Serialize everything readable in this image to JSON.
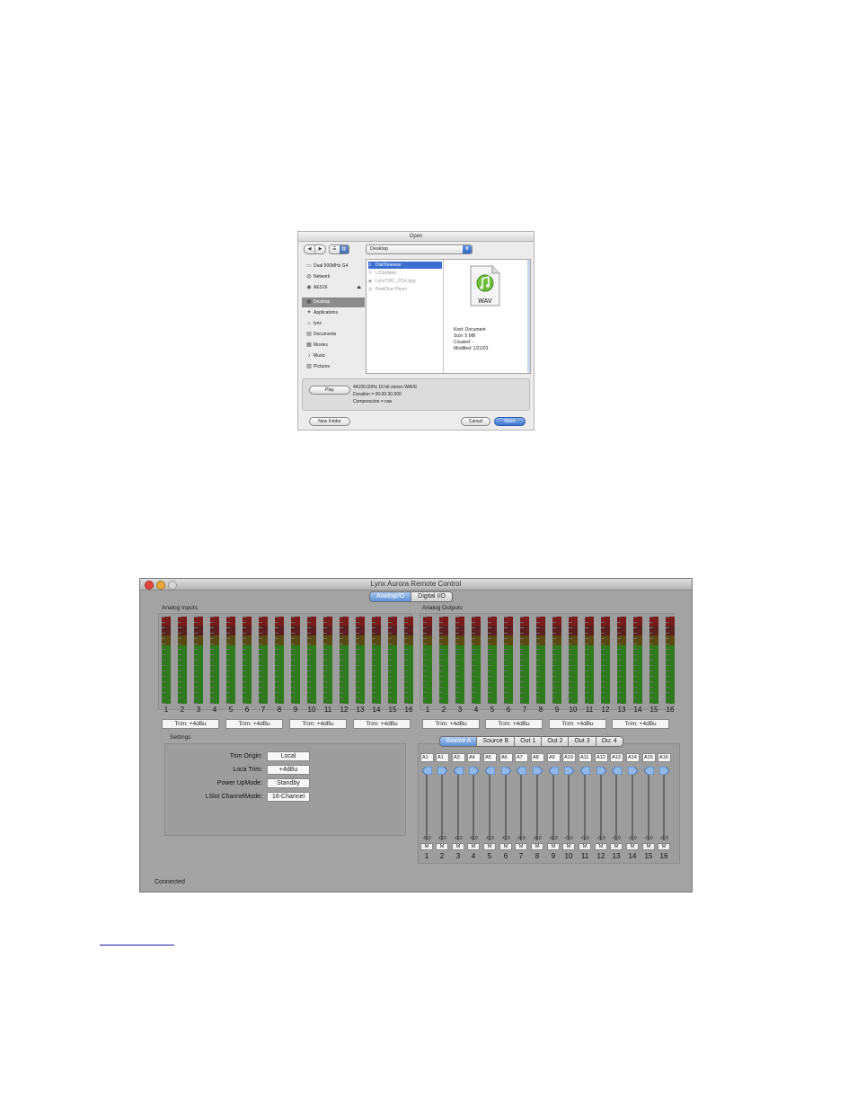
{
  "open_dialog": {
    "title": "Open",
    "nav": {
      "back": "◀",
      "forward": "▶"
    },
    "views": {
      "list": "☰",
      "columns": "▥"
    },
    "location": "Desktop",
    "sidebar": [
      {
        "label": "Dual 500MHz G4",
        "icon": "computer-icon"
      },
      {
        "label": "Network",
        "icon": "network-icon"
      },
      {
        "label": "AES16",
        "icon": "disk-icon",
        "eject": "⏏"
      },
      {
        "label": "Desktop",
        "icon": "desktop-icon",
        "selected": true
      },
      {
        "label": "Applications",
        "icon": "applications-icon"
      },
      {
        "label": "lynx",
        "icon": "home-icon"
      },
      {
        "label": "Documents",
        "icon": "documents-icon"
      },
      {
        "label": "Movies",
        "icon": "movies-icon"
      },
      {
        "label": "Music",
        "icon": "music-icon"
      },
      {
        "label": "Pictures",
        "icon": "pictures-icon"
      }
    ],
    "files": [
      {
        "label": "DialTonewav",
        "selected": true
      },
      {
        "label": "L2Updater"
      },
      {
        "label": "LynxTWC_OSX.pkg"
      },
      {
        "label": "RealOne Player"
      }
    ],
    "preview": {
      "badge": "WAV",
      "kind": "Kind: Document",
      "size": "Size: 5 MB",
      "created": "Created: -",
      "modified": "Modified: 1/21/03"
    },
    "info": {
      "play_label": "Play",
      "format": "44100.00Hz 16 bit stereo WAVE",
      "duration": "Duration = 00:00:30.000",
      "compression": "Compression = raw"
    },
    "buttons": {
      "new_folder": "New Folder",
      "cancel": "Cancel",
      "open": "Open"
    }
  },
  "aurora": {
    "title": "Lynx Aurora Remote Control",
    "tabs": [
      {
        "label": "AnalogI/O",
        "active": true
      },
      {
        "label": "Digital I/O"
      }
    ],
    "analog_inputs_label": "Analog Inputs",
    "analog_outputs_label": "Analog Outputs",
    "channel_numbers": [
      "1",
      "2",
      "3",
      "4",
      "5",
      "6",
      "7",
      "8",
      "9",
      "10",
      "11",
      "12",
      "13",
      "14",
      "15",
      "16"
    ],
    "input_levels": [
      0.67,
      0.67,
      0.67,
      0.67,
      0.67,
      0.67,
      0.67,
      0.67,
      0.67,
      0.67,
      0.67,
      0.67,
      0.67,
      0.67,
      0.67,
      0.67
    ],
    "output_levels": [
      0.67,
      0.67,
      0.67,
      0.67,
      0.67,
      0.67,
      0.67,
      0.67,
      0.67,
      0.67,
      0.67,
      0.67,
      0.67,
      0.67,
      0.67,
      0.67
    ],
    "input_trims": [
      "Trim: +4dBu",
      "Trim: +4dBu",
      "Trim: +4dBu",
      "Trim: +4dBu"
    ],
    "output_trims": [
      "Trim: +4dBu",
      "Trim: +4dBu",
      "Trim: +4dBu",
      "Trim: +4dBu"
    ],
    "settings": {
      "label": "Settings",
      "rows": [
        {
          "label": "Trim Origin:",
          "value": "Local"
        },
        {
          "label": "Loca Trim:",
          "value": "+4dBu"
        },
        {
          "label": "Power UpMode:",
          "value": "Standby"
        },
        {
          "label": "LSlot ChannelMode:",
          "value": "16-Channel"
        }
      ]
    },
    "source_tabs": [
      {
        "label": "Source A",
        "active": true
      },
      {
        "label": "Source B"
      },
      {
        "label": "Out 1"
      },
      {
        "label": "Out 2"
      },
      {
        "label": "Out 3"
      },
      {
        "label": "Ou: 4"
      }
    ],
    "sources": [
      "A1",
      "A1",
      "A3",
      "A4",
      "A5",
      "A6",
      "A7",
      "A8",
      "A9",
      "A10",
      "A11",
      "A12",
      "A13",
      "A14",
      "A15",
      "A16"
    ],
    "fader_values": [
      "-0.0",
      "-0.0",
      "-0.0",
      "-0.0",
      "-0.0",
      "-0.0",
      "-0.0",
      "-0.0",
      "-0.0",
      "-0.0",
      "-0.0",
      "-0.0",
      "-0.0",
      "-0.0",
      "-0.0",
      "-0.0"
    ],
    "mute_label": "M",
    "status": "Connected"
  }
}
